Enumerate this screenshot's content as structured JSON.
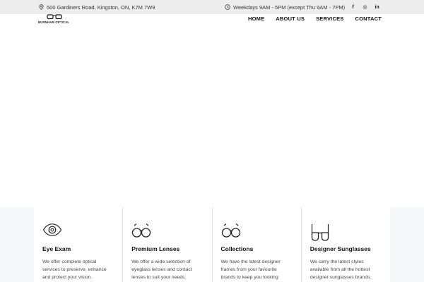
{
  "topbar": {
    "address": "500 Gardiners Road, Kingston, ON, K7M 7W9",
    "hours": "Weekdays 9AM - 5PM (except Thu 9AM - 7PM)",
    "social": [
      {
        "icon": "facebook-icon",
        "glyph": "f"
      },
      {
        "icon": "instagram-icon",
        "glyph": "◎"
      },
      {
        "icon": "linkedin-icon",
        "glyph": "in"
      }
    ]
  },
  "logo": {
    "text": "BURNHAM OPTICAL"
  },
  "nav": [
    "HOME",
    "ABOUT US",
    "SERVICES",
    "CONTACT"
  ],
  "services": [
    {
      "icon": "eye-icon",
      "title": "Eye Exam",
      "text": "We offer complete optical services to preserve, enhance and protect your vision."
    },
    {
      "icon": "glasses-icon",
      "title": "Premium Lenses",
      "text": "We offer a wide selection of eyeglass lenses and contact lenses to suit your needs."
    },
    {
      "icon": "glasses-icon",
      "title": "Collections",
      "text": "We have the latest designer frames from your favourite brands to keep you looking"
    },
    {
      "icon": "sunglasses-icon",
      "title": "Designer Sunglasses",
      "text": "We carry the latest styles available from all the hottest designer sunglasses brands."
    }
  ]
}
